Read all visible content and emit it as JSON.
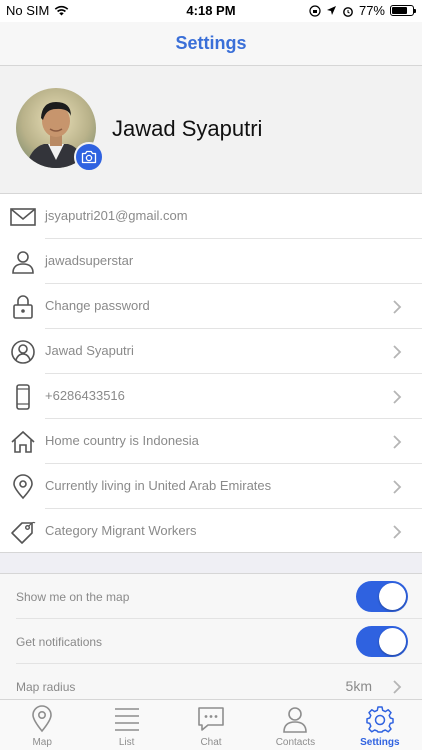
{
  "status_bar": {
    "carrier": "No SIM",
    "time": "4:18 PM",
    "battery": "77%",
    "battery_level": 0.77
  },
  "nav": {
    "title": "Settings"
  },
  "profile": {
    "name": "Jawad Syaputri"
  },
  "info_rows": [
    {
      "icon": "mail-icon",
      "text": "jsyaputri201@gmail.com",
      "chevron": false
    },
    {
      "icon": "user-icon",
      "text": "jawadsuperstar",
      "chevron": false
    },
    {
      "icon": "lock-icon",
      "text": "Change password",
      "chevron": true
    },
    {
      "icon": "user-circle-icon",
      "text": "Jawad Syaputri",
      "chevron": true
    },
    {
      "icon": "phone-icon",
      "text": "+6286433516",
      "chevron": true
    },
    {
      "icon": "home-icon",
      "text": "Home country is Indonesia",
      "chevron": true
    },
    {
      "icon": "location-pin-icon",
      "text": "Currently living in United Arab Emirates",
      "chevron": true
    },
    {
      "icon": "tag-icon",
      "text": "Category Migrant Workers",
      "chevron": true
    }
  ],
  "settings": {
    "show_on_map": {
      "label": "Show me on the map",
      "on": true
    },
    "notifications": {
      "label": "Get notifications",
      "on": true
    },
    "map_radius": {
      "label": "Map radius",
      "value": "5km"
    }
  },
  "tabs": [
    {
      "icon": "map-pin-icon",
      "label": "Map",
      "active": false
    },
    {
      "icon": "list-icon",
      "label": "List",
      "active": false
    },
    {
      "icon": "chat-icon",
      "label": "Chat",
      "active": false
    },
    {
      "icon": "contacts-icon",
      "label": "Contacts",
      "active": false
    },
    {
      "icon": "gear-icon",
      "label": "Settings",
      "active": true
    }
  ],
  "colors": {
    "accent": "#2f62e0",
    "title": "#3a6fd8",
    "muted_text": "#8a8a8a"
  }
}
